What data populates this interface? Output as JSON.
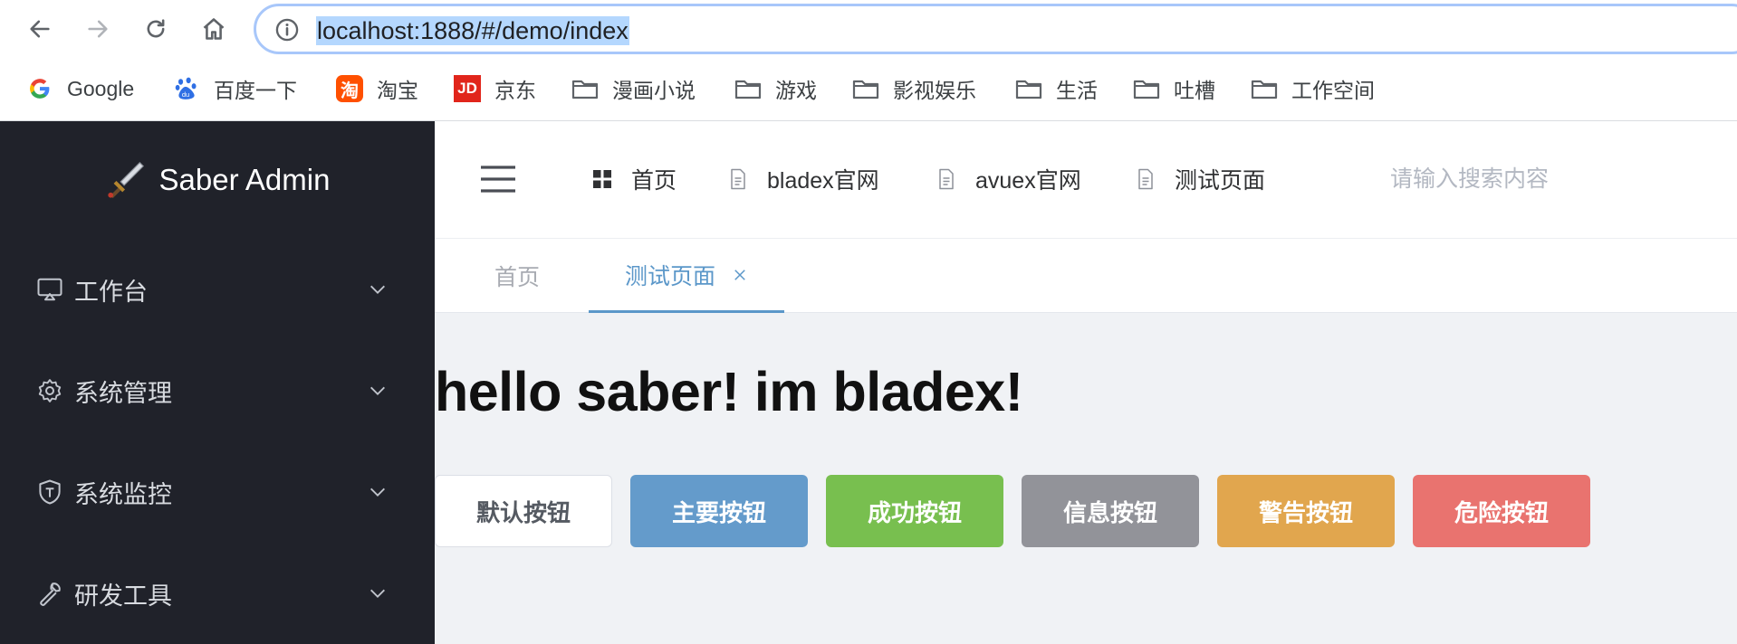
{
  "browser": {
    "url": "localhost:1888/#/demo/index",
    "bookmarks": [
      {
        "label": "Google",
        "icon": "google-icon"
      },
      {
        "label": "百度一下",
        "icon": "baidu-icon"
      },
      {
        "label": "淘宝",
        "icon": "taobao-icon"
      },
      {
        "label": "京东",
        "icon": "jd-icon"
      },
      {
        "label": "漫画小说",
        "icon": "folder-icon"
      },
      {
        "label": "游戏",
        "icon": "folder-icon"
      },
      {
        "label": "影视娱乐",
        "icon": "folder-icon"
      },
      {
        "label": "生活",
        "icon": "folder-icon"
      },
      {
        "label": "吐槽",
        "icon": "folder-icon"
      },
      {
        "label": "工作空间",
        "icon": "folder-icon"
      }
    ],
    "taobao_glyph": "淘",
    "jd_glyph": "JD"
  },
  "sidebar": {
    "app_title": "Saber Admin",
    "menu": [
      {
        "label": "工作台",
        "icon": "monitor-icon"
      },
      {
        "label": "系统管理",
        "icon": "gear-icon"
      },
      {
        "label": "系统监控",
        "icon": "shield-icon"
      },
      {
        "label": "研发工具",
        "icon": "wrench-icon"
      }
    ]
  },
  "header": {
    "nav": [
      {
        "label": "首页",
        "icon": "grid-icon"
      },
      {
        "label": "bladex官网",
        "icon": "document-icon"
      },
      {
        "label": "avuex官网",
        "icon": "document-icon"
      },
      {
        "label": "测试页面",
        "icon": "document-icon"
      }
    ],
    "search_placeholder": "请输入搜索内容"
  },
  "tabs": [
    {
      "label": "首页",
      "active": false
    },
    {
      "label": "测试页面",
      "active": true
    }
  ],
  "content": {
    "heading": "hello saber! im bladex!",
    "buttons": [
      {
        "label": "默认按钮",
        "type": "default"
      },
      {
        "label": "主要按钮",
        "type": "primary",
        "color": "#649bcb"
      },
      {
        "label": "成功按钮",
        "type": "success",
        "color": "#78bf4f"
      },
      {
        "label": "信息按钮",
        "type": "info",
        "color": "#929399"
      },
      {
        "label": "警告按钮",
        "type": "warning",
        "color": "#e1a64e"
      },
      {
        "label": "危险按钮",
        "type": "danger",
        "color": "#e9736f"
      }
    ]
  },
  "colors": {
    "sidebar_bg": "#20222a",
    "accent": "#5b97c9",
    "content_bg": "#f0f2f5"
  }
}
